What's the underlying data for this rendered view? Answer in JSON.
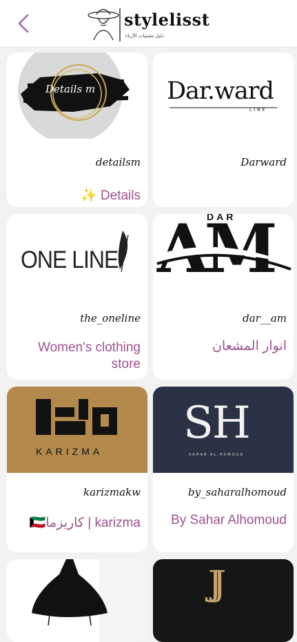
{
  "header": {
    "brand": "stylelisst",
    "tagline": "دليل مقتنيات الأزياء",
    "back_icon": "chevron-left-icon"
  },
  "colors": {
    "accent": "#a0508e",
    "back": "#9b6aa9"
  },
  "cards": [
    {
      "handle": "detailsm",
      "description": "✨ Details",
      "logo_text": "Details m"
    },
    {
      "handle": "Darward",
      "description": "",
      "logo_text": "Dar.ward",
      "logo_sub": "LINE"
    },
    {
      "handle": "the_oneline",
      "description": "Women's clothing store",
      "logo_text": "ONE LINE"
    },
    {
      "handle": "dar__am",
      "description": "انوار المشعان",
      "logo_text": "AM",
      "logo_top": "DAR"
    },
    {
      "handle": "karizmakw",
      "description": "🇰🇼كاريزما | karizma",
      "logo_text": "KARIZMA"
    },
    {
      "handle": "by_saharalhomoud",
      "description": "By Sahar Alhomoud",
      "logo_text": "SH",
      "logo_sub": "SAHAR AL HOMOUD"
    },
    {
      "handle": "",
      "description": "",
      "logo_text": ""
    },
    {
      "handle": "",
      "description": "",
      "logo_text": "JJ"
    }
  ]
}
